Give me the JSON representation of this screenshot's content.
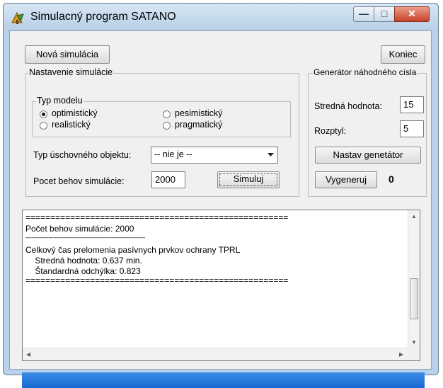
{
  "window": {
    "title": "Simulacný program SATANO",
    "controls": {
      "minimize": "—",
      "maximize": "□",
      "close": "✕"
    }
  },
  "toolbar": {
    "new_simulation": "Nová simulácia",
    "end": "Koniec"
  },
  "settings": {
    "group_title": "Nastavenie simulácie",
    "model_group_title": "Typ modelu",
    "model_options": [
      {
        "label": "optimistický",
        "selected": true
      },
      {
        "label": "pesimistický",
        "selected": false
      },
      {
        "label": "realistický",
        "selected": false
      },
      {
        "label": "pragmatický",
        "selected": false
      }
    ],
    "object_type_label": "Typ úschovného objektu:",
    "object_type_value": "-- nie je --",
    "runs_label": "Pocet behov simulácie:",
    "runs_value": "2000",
    "simulate_button": "Simuluj"
  },
  "generator": {
    "group_title": "Generátor náhodného císla",
    "mean_label": "Stredná hodnota:",
    "mean_value": "15",
    "variance_label": "Rozptyl:",
    "variance_value": "5",
    "set_button": "Nastav genetátor",
    "generate_button": "Vygeneruj",
    "generated_value": "0"
  },
  "output": {
    "lines": [
      "=====================================================",
      "Počet behov simulácie: 2000",
      "------------------------------------------------------------------------------",
      "Celkový čas prelomenia pasívnych prvkov ochrany TPRL",
      "    Stredná hodnota: 0.637 min.",
      "    Štandardná odchýlka: 0.823",
      "====================================================="
    ]
  },
  "colors": {
    "titlebar": "#c5d9ee",
    "status": "#2a7ada",
    "client": "#f0f0f0"
  },
  "icons": {
    "app": "app-tree-icon"
  }
}
